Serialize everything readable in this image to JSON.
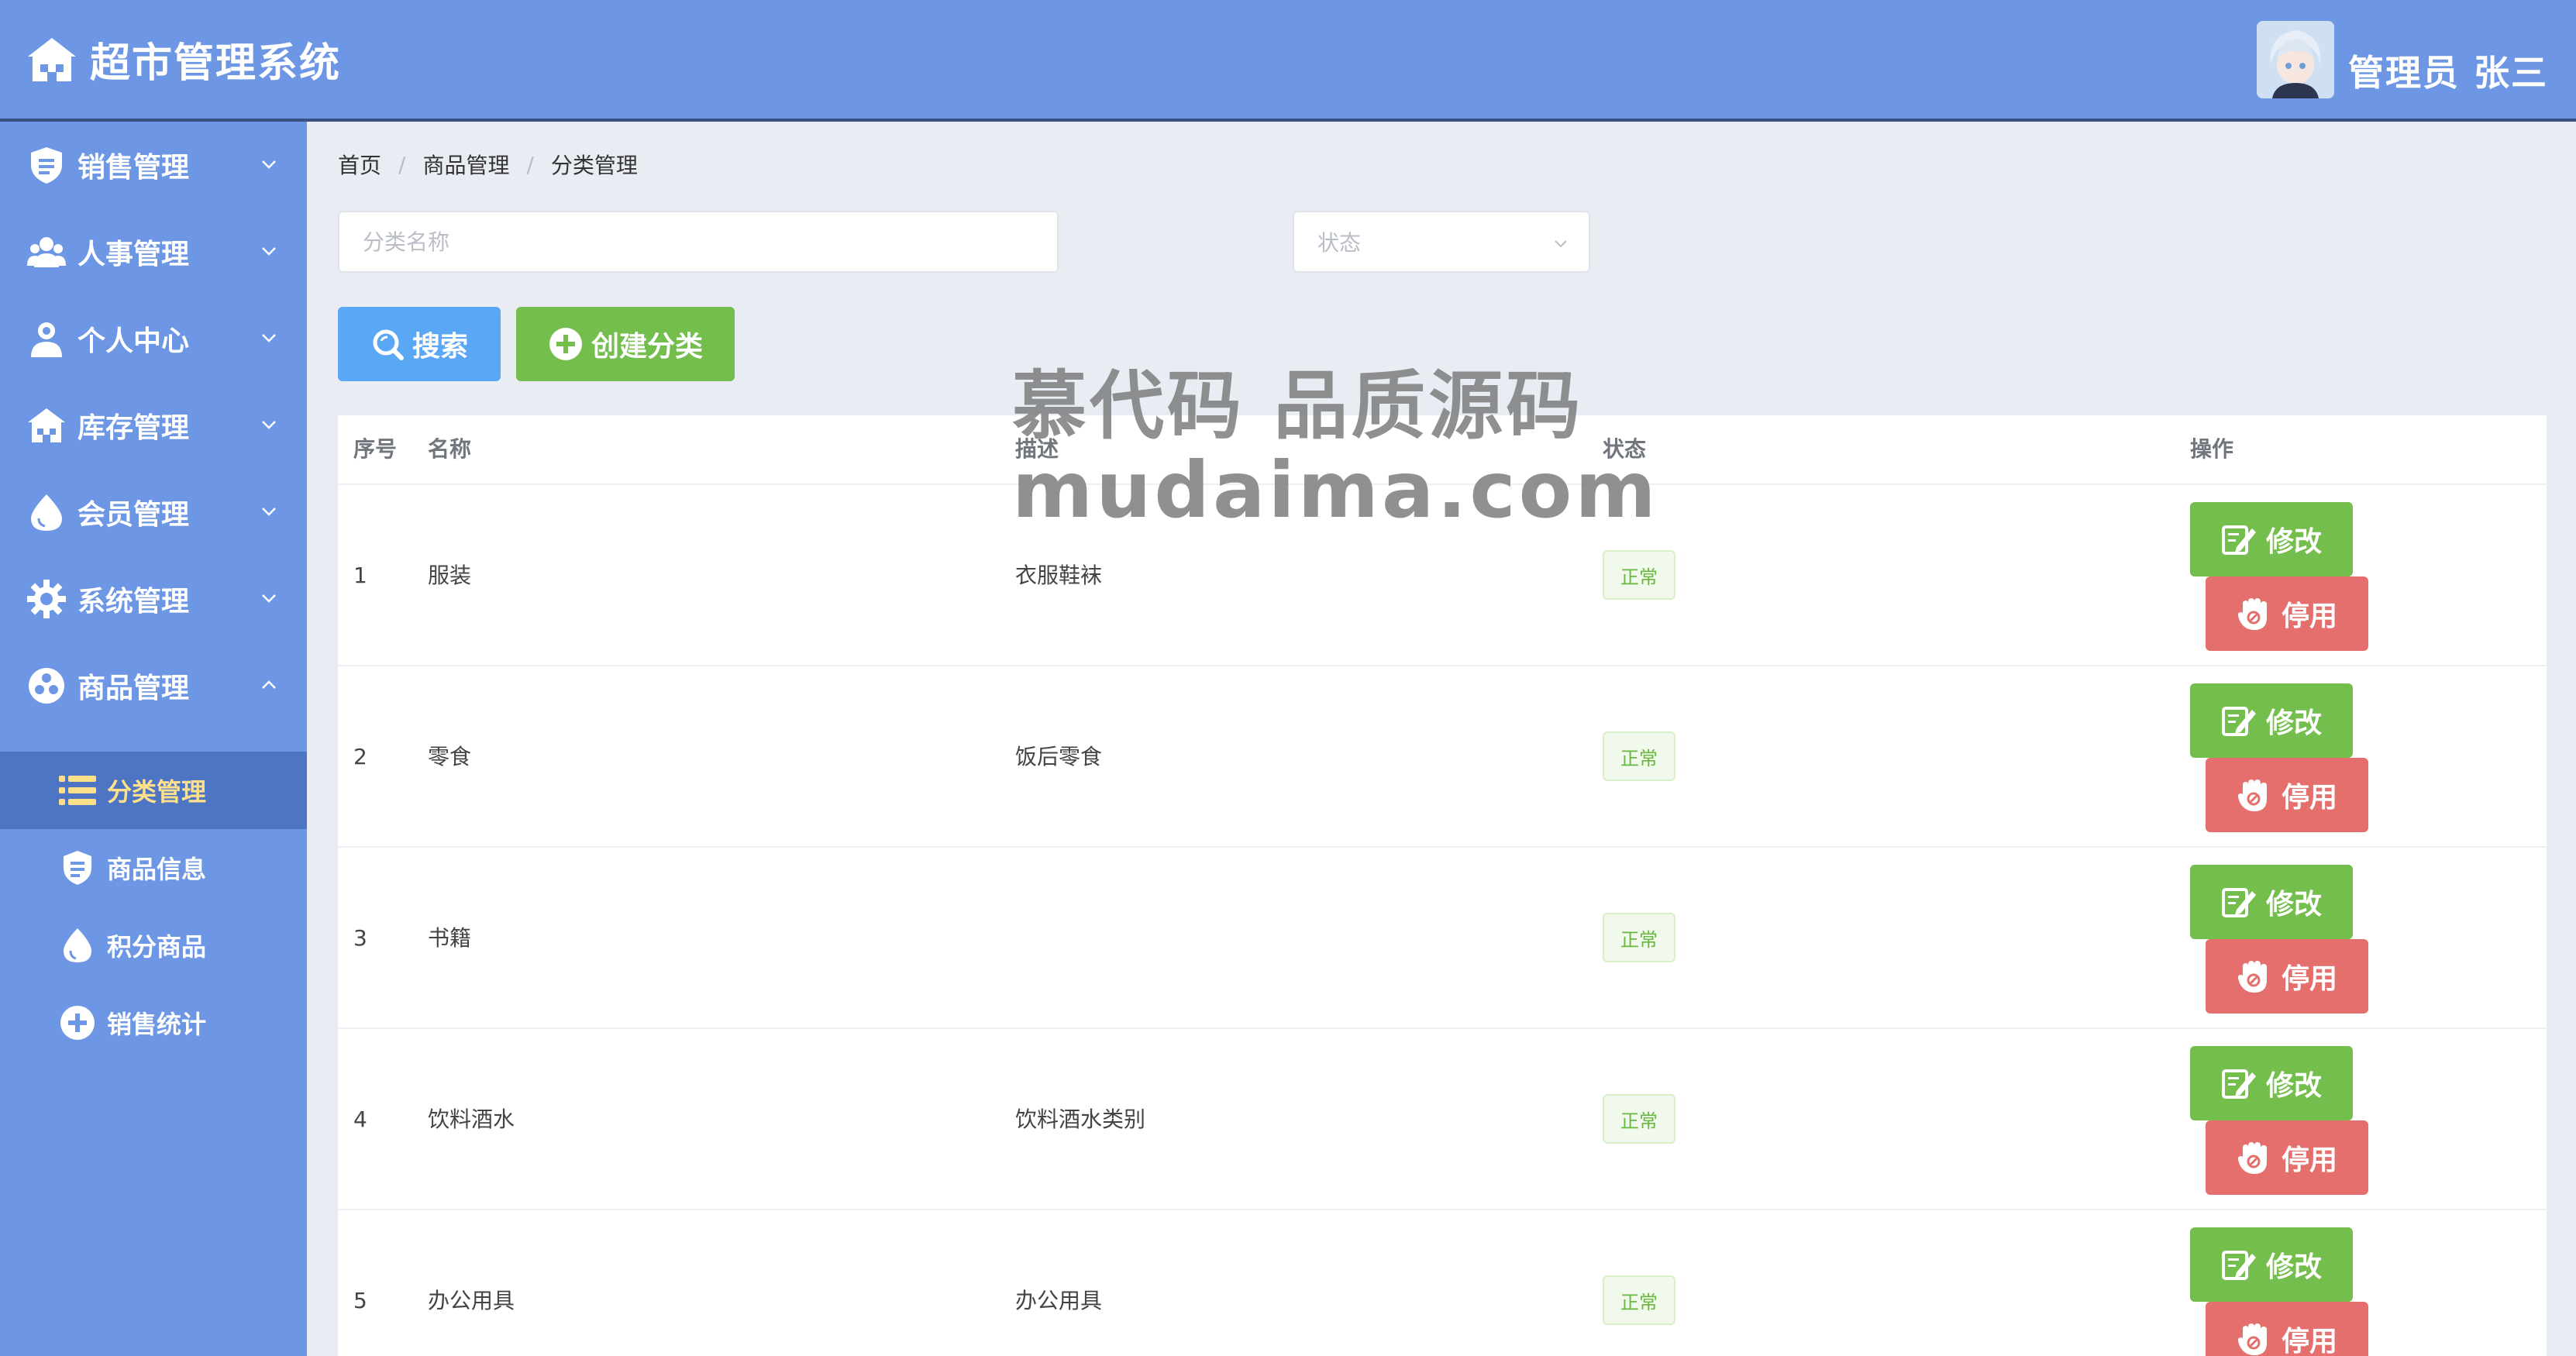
{
  "header": {
    "title": "超市管理系统",
    "user_name": "管理员 张三",
    "home_icon": "home-icon"
  },
  "sidebar": {
    "menus": [
      {
        "label": "销售管理",
        "icon": "shield-icon",
        "expanded": false
      },
      {
        "label": "人事管理",
        "icon": "users-icon",
        "expanded": false
      },
      {
        "label": "个人中心",
        "icon": "user-icon",
        "expanded": false
      },
      {
        "label": "库存管理",
        "icon": "warehouse-icon",
        "expanded": false
      },
      {
        "label": "会员管理",
        "icon": "drop-icon",
        "expanded": false
      },
      {
        "label": "系统管理",
        "icon": "gear-icon",
        "expanded": false
      },
      {
        "label": "商品管理",
        "icon": "goods-icon",
        "expanded": true
      }
    ],
    "sub_items": [
      {
        "label": "分类管理",
        "icon": "list-icon",
        "active": true
      },
      {
        "label": "商品信息",
        "icon": "shield-icon",
        "active": false
      },
      {
        "label": "积分商品",
        "icon": "drop-icon",
        "active": false
      },
      {
        "label": "销售统计",
        "icon": "plus-circle-icon",
        "active": false
      }
    ]
  },
  "breadcrumb": [
    "首页",
    "商品管理",
    "分类管理"
  ],
  "filters": {
    "name_placeholder": "分类名称",
    "name_value": "",
    "status_placeholder": "状态"
  },
  "buttons": {
    "search": "搜索",
    "create": "创建分类"
  },
  "table": {
    "columns": [
      "序号",
      "名称",
      "描述",
      "状态",
      "操作"
    ],
    "rows": [
      {
        "no": "1",
        "name": "服装",
        "desc": "衣服鞋袜",
        "status": "正常"
      },
      {
        "no": "2",
        "name": "零食",
        "desc": "饭后零食",
        "status": "正常"
      },
      {
        "no": "3",
        "name": "书籍",
        "desc": "",
        "status": "正常"
      },
      {
        "no": "4",
        "name": "饮料酒水",
        "desc": "饮料酒水类别",
        "status": "正常"
      },
      {
        "no": "5",
        "name": "办公用具",
        "desc": "办公用具",
        "status": "正常"
      }
    ],
    "edit_label": "修改",
    "disable_label": "停用"
  },
  "watermark": {
    "line1": "慕代码 品质源码",
    "line2": "mudaima.com"
  },
  "colors": {
    "primary": "#6d97e5",
    "active_sub_bg": "#4e74c4",
    "active_sub_text": "#ffe08a",
    "search": "#5aa7f5",
    "success": "#73be4c",
    "danger": "#e56f6d",
    "tag_text": "#67b83e"
  }
}
